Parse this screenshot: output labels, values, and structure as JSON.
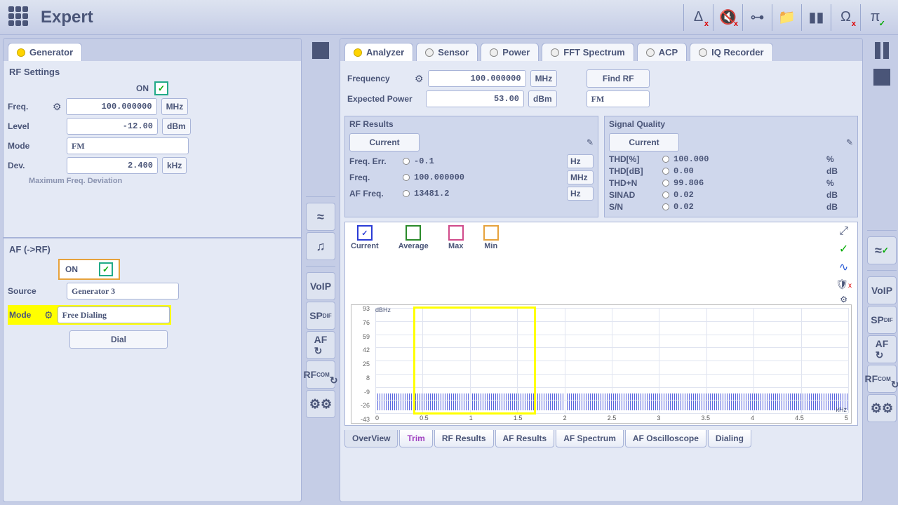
{
  "title": "Expert",
  "generator": {
    "tab": "Generator",
    "section_rf": "RF Settings",
    "on_label": "ON",
    "freq_label": "Freq.",
    "freq_value": "100.000000",
    "freq_unit": "MHz",
    "level_label": "Level",
    "level_value": "-12.00",
    "level_unit": "dBm",
    "mode_label": "Mode",
    "mode_value": "FM",
    "dev_label": "Dev.",
    "dev_value": "2.400",
    "dev_unit": "kHz",
    "dev_note": "Maximum Freq. Deviation",
    "section_af": "AF (->RF)",
    "af_on": "ON",
    "source_label": "Source",
    "source_value": "Generator 3",
    "af_mode_label": "Mode",
    "af_mode_value": "Free Dialing",
    "dial_btn": "Dial"
  },
  "analyzer": {
    "tabs": [
      "Analyzer",
      "Sensor",
      "Power",
      "FFT Spectrum",
      "ACP",
      "IQ Recorder"
    ],
    "freq_label": "Frequency",
    "freq_value": "100.000000",
    "freq_unit": "MHz",
    "find_rf": "Find RF",
    "exp_power_label": "Expected  Power",
    "exp_power_value": "53.00",
    "exp_power_unit": "dBm",
    "demod": "FM",
    "rf_results_title": "RF Results",
    "sq_title": "Signal Quality",
    "current_label": "Current",
    "rf_rows": [
      {
        "label": "Freq. Err.",
        "value": "-0.1",
        "unit": "Hz"
      },
      {
        "label": "Freq.",
        "value": "100.000000",
        "unit": "MHz"
      },
      {
        "label": "AF Freq.",
        "value": "13481.2",
        "unit": "Hz"
      }
    ],
    "sq_rows": [
      {
        "label": "THD[%]",
        "value": "100.000",
        "unit": "%"
      },
      {
        "label": "THD[dB]",
        "value": "0.00",
        "unit": "dB"
      },
      {
        "label": "THD+N",
        "value": "99.806",
        "unit": "%"
      },
      {
        "label": "SINAD",
        "value": "0.02",
        "unit": "dB"
      },
      {
        "label": "S/N",
        "value": "0.02",
        "unit": "dB"
      }
    ],
    "legend": [
      "Current",
      "Average",
      "Max",
      "Min"
    ],
    "bottom_tabs": [
      "OverView",
      "Trim",
      "RF Results",
      "AF Results",
      "AF Spectrum",
      "AF Oscilloscope",
      "Dialing"
    ]
  },
  "side_left": [
    "≈",
    "♫",
    "VoIP",
    "SP",
    "AF",
    "RF"
  ],
  "side_right_upper": [
    "≈",
    "VoIP",
    "SP",
    "AF",
    "RF"
  ],
  "chart_data": {
    "type": "line",
    "title": "",
    "y_unit": "dBHz",
    "x_unit": "kHz",
    "xlim": [
      0,
      5
    ],
    "ylim": [
      -50,
      95
    ],
    "y_ticks": [
      93,
      76,
      59,
      42,
      25,
      8,
      -9,
      -26,
      -43
    ],
    "x_ticks": [
      0,
      0.5,
      1,
      1.5,
      2,
      2.5,
      3,
      3.5,
      4,
      4.5,
      5
    ],
    "noise_floor_db": -26,
    "series": [
      {
        "name": "Current",
        "color": "#2a3bd6",
        "checked": true
      },
      {
        "name": "Average",
        "color": "#2a8a2a",
        "checked": false
      },
      {
        "name": "Max",
        "color": "#d04a8a",
        "checked": false
      },
      {
        "name": "Min",
        "color": "#e6a23c",
        "checked": false
      }
    ]
  }
}
